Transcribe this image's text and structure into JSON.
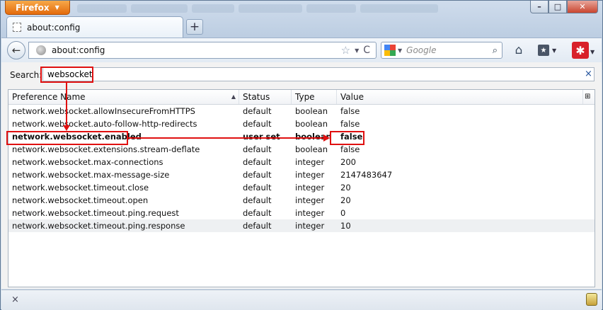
{
  "window": {
    "app_button": "Firefox",
    "controls": {
      "minimize": "–",
      "maximize": "□",
      "close": "✕"
    }
  },
  "tabs": [
    {
      "title": "about:config"
    }
  ],
  "new_tab_label": "+",
  "toolbar": {
    "back_icon": "←",
    "url": "about:config",
    "search_engine_placeholder": "Google",
    "search_glyph": "⌕",
    "home_icon": "⌂",
    "reload_icon": "C",
    "bookmark_star": "☆"
  },
  "filter": {
    "label": "Search:",
    "value": "websocket",
    "clear_icon": "×"
  },
  "table": {
    "columns": [
      "Preference Name",
      "Status",
      "Type",
      "Value"
    ],
    "rows": [
      {
        "name": "network.websocket.allowInsecureFromHTTPS",
        "status": "default",
        "type": "boolean",
        "value": "false"
      },
      {
        "name": "network.websocket.auto-follow-http-redirects",
        "status": "default",
        "type": "boolean",
        "value": "false"
      },
      {
        "name": "network.websocket.enabled",
        "status": "user set",
        "type": "boolean",
        "value": "false",
        "modified": true
      },
      {
        "name": "network.websocket.extensions.stream-deflate",
        "status": "default",
        "type": "boolean",
        "value": "false"
      },
      {
        "name": "network.websocket.max-connections",
        "status": "default",
        "type": "integer",
        "value": "200"
      },
      {
        "name": "network.websocket.max-message-size",
        "status": "default",
        "type": "integer",
        "value": "2147483647"
      },
      {
        "name": "network.websocket.timeout.close",
        "status": "default",
        "type": "integer",
        "value": "20"
      },
      {
        "name": "network.websocket.timeout.open",
        "status": "default",
        "type": "integer",
        "value": "20"
      },
      {
        "name": "network.websocket.timeout.ping.request",
        "status": "default",
        "type": "integer",
        "value": "0"
      },
      {
        "name": "network.websocket.timeout.ping.response",
        "status": "default",
        "type": "integer",
        "value": "10"
      }
    ]
  },
  "statusbar": {
    "close_icon": "×"
  },
  "colors": {
    "annotation": "#e01010",
    "firefox_orange": "#e46b0c"
  }
}
